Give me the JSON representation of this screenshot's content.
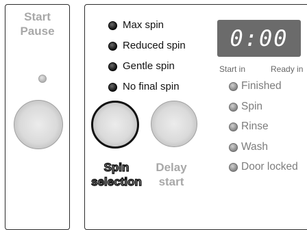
{
  "start_pause": {
    "line1": "Start",
    "line2": "Pause"
  },
  "spin_options": [
    {
      "label": "Max spin"
    },
    {
      "label": "Reduced spin"
    },
    {
      "label": "Gentle spin"
    },
    {
      "label": "No final spin"
    }
  ],
  "display": {
    "time": "0:00",
    "start_in": "Start in",
    "ready_in": "Ready in"
  },
  "status": [
    {
      "label": "Finished"
    },
    {
      "label": "Spin"
    },
    {
      "label": "Rinse"
    },
    {
      "label": "Wash"
    },
    {
      "label": "Door locked"
    }
  ],
  "buttons": {
    "spin_selection": {
      "line1": "Spin",
      "line2": "selection"
    },
    "delay_start": {
      "line1": "Delay",
      "line2": "start"
    }
  },
  "colors": {
    "display_bg": "#6b6b6b",
    "label_gray": "#a8a8a8",
    "led_dark": "#111111"
  }
}
